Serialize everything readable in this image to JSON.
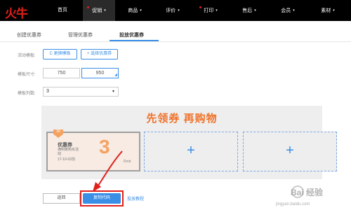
{
  "brand": {
    "logo": "火牛"
  },
  "nav": {
    "items": [
      {
        "label": "首页",
        "dropdown": "",
        "dot": false,
        "active": false
      },
      {
        "label": "促销",
        "dropdown": "▾",
        "dot": true,
        "active": true
      },
      {
        "label": "商品",
        "dropdown": "▾",
        "dot": false,
        "active": false
      },
      {
        "label": "评价",
        "dropdown": "▾",
        "dot": false,
        "active": false
      },
      {
        "label": "打印",
        "dropdown": "▾",
        "dot": true,
        "active": false
      },
      {
        "label": "售后",
        "dropdown": "▾",
        "dot": false,
        "active": false
      },
      {
        "label": "会员",
        "dropdown": "▾",
        "dot": false,
        "active": false
      },
      {
        "label": "素材",
        "dropdown": "▾",
        "dot": false,
        "active": false
      }
    ]
  },
  "tabs": [
    {
      "label": "创建优惠券"
    },
    {
      "label": "管理优惠券"
    },
    {
      "label": "投放优惠券",
      "active": true
    }
  ],
  "form": {
    "template_label": "活动模板:",
    "change_template_button": "C 更换模板",
    "select_coupon_button": "+ 选择优惠券",
    "size_label": "模板尺寸:",
    "width_value": "750",
    "height_value": "950",
    "columns_label": "模板列数:",
    "columns_value": "3"
  },
  "preview": {
    "title": "先领券 再购物",
    "coupon": {
      "badge": "30",
      "title": "优惠券",
      "subtitle": "满明菜购买活动",
      "date": "17-10-02前",
      "value": "3",
      "unit": "Rmb"
    },
    "empty_slot_icon": "+"
  },
  "actions": {
    "back": "返回",
    "copy_code": "复制代码",
    "tutorial": "投放教程"
  },
  "watermark": {
    "text": "Bai 经验",
    "url": "jingyan.baidu.com"
  },
  "colors": {
    "accent": "#3a8ee6",
    "brand_red": "#e0201b",
    "headline_orange": "#f0722b",
    "coupon_orange": "#f5a260"
  }
}
